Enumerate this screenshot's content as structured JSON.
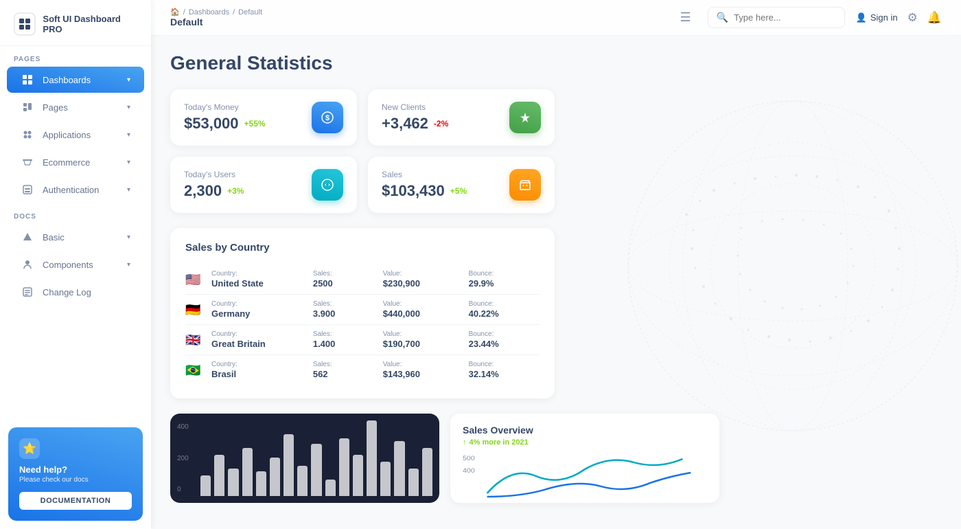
{
  "sidebar": {
    "logo": {
      "icon": "⊞",
      "text": "Soft UI Dashboard PRO"
    },
    "pages_label": "PAGES",
    "docs_label": "DOCS",
    "items_pages": [
      {
        "id": "dashboards",
        "label": "Dashboards",
        "icon": "⊞",
        "active": true,
        "hasArrow": true
      },
      {
        "id": "pages",
        "label": "Pages",
        "icon": "📊",
        "active": false,
        "hasArrow": true
      },
      {
        "id": "applications",
        "label": "Applications",
        "icon": "🔧",
        "active": false,
        "hasArrow": true
      },
      {
        "id": "ecommerce",
        "label": "Ecommerce",
        "icon": "🏷",
        "active": false,
        "hasArrow": true
      },
      {
        "id": "authentication",
        "label": "Authentication",
        "icon": "📄",
        "active": false,
        "hasArrow": true
      }
    ],
    "items_docs": [
      {
        "id": "basic",
        "label": "Basic",
        "icon": "🚀",
        "active": false,
        "hasArrow": true
      },
      {
        "id": "components",
        "label": "Components",
        "icon": "👤",
        "active": false,
        "hasArrow": true
      },
      {
        "id": "changelog",
        "label": "Change Log",
        "icon": "🗒",
        "active": false,
        "hasArrow": false
      }
    ],
    "help": {
      "star": "⭐",
      "title": "Need help?",
      "subtitle": "Please check our docs",
      "button": "DOCUMENTATION"
    }
  },
  "header": {
    "home_icon": "🏠",
    "breadcrumb_sep": "/",
    "breadcrumb_dashboards": "Dashboards",
    "breadcrumb_current": "Default",
    "page_title": "Default",
    "menu_icon": "☰",
    "search_placeholder": "Type here...",
    "signin_label": "Sign in",
    "settings_icon": "⚙",
    "bell_icon": "🔔"
  },
  "main": {
    "title": "General Statistics",
    "stats": [
      {
        "id": "money",
        "label": "Today's Money",
        "value": "$53,000",
        "change": "+55%",
        "change_type": "positive",
        "icon": "💲",
        "icon_type": "blue"
      },
      {
        "id": "clients",
        "label": "New Clients",
        "value": "+3,462",
        "change": "-2%",
        "change_type": "negative",
        "icon": "🏆",
        "icon_type": "green"
      },
      {
        "id": "users",
        "label": "Today's Users",
        "value": "2,300",
        "change": "+3%",
        "change_type": "positive",
        "icon": "🌐",
        "icon_type": "teal"
      },
      {
        "id": "sales",
        "label": "Sales",
        "value": "$103,430",
        "change": "+5%",
        "change_type": "positive",
        "icon": "🛒",
        "icon_type": "orange"
      }
    ],
    "sales_by_country": {
      "title": "Sales by Country",
      "columns": [
        "Country:",
        "Sales:",
        "Value:",
        "Bounce:"
      ],
      "rows": [
        {
          "flag": "🇺🇸",
          "country": "United State",
          "sales": "2500",
          "value": "$230,900",
          "bounce": "29.9%"
        },
        {
          "flag": "🇩🇪",
          "country": "Germany",
          "sales": "3.900",
          "value": "$440,000",
          "bounce": "40.22%"
        },
        {
          "flag": "🇬🇧",
          "country": "Great Britain",
          "sales": "1.400",
          "value": "$190,700",
          "bounce": "23.44%"
        },
        {
          "flag": "🇧🇷",
          "country": "Brasil",
          "sales": "562",
          "value": "$143,960",
          "bounce": "32.14%"
        }
      ]
    },
    "bar_chart": {
      "y_labels": [
        "400",
        "200",
        "0"
      ],
      "bars": [
        15,
        30,
        20,
        35,
        18,
        28,
        45,
        22,
        38,
        12,
        42,
        30,
        55,
        25,
        40,
        20,
        35
      ]
    },
    "sales_overview": {
      "title": "Sales Overview",
      "subtitle": "4% more in 2021",
      "y_labels": [
        "500",
        "400"
      ]
    }
  }
}
